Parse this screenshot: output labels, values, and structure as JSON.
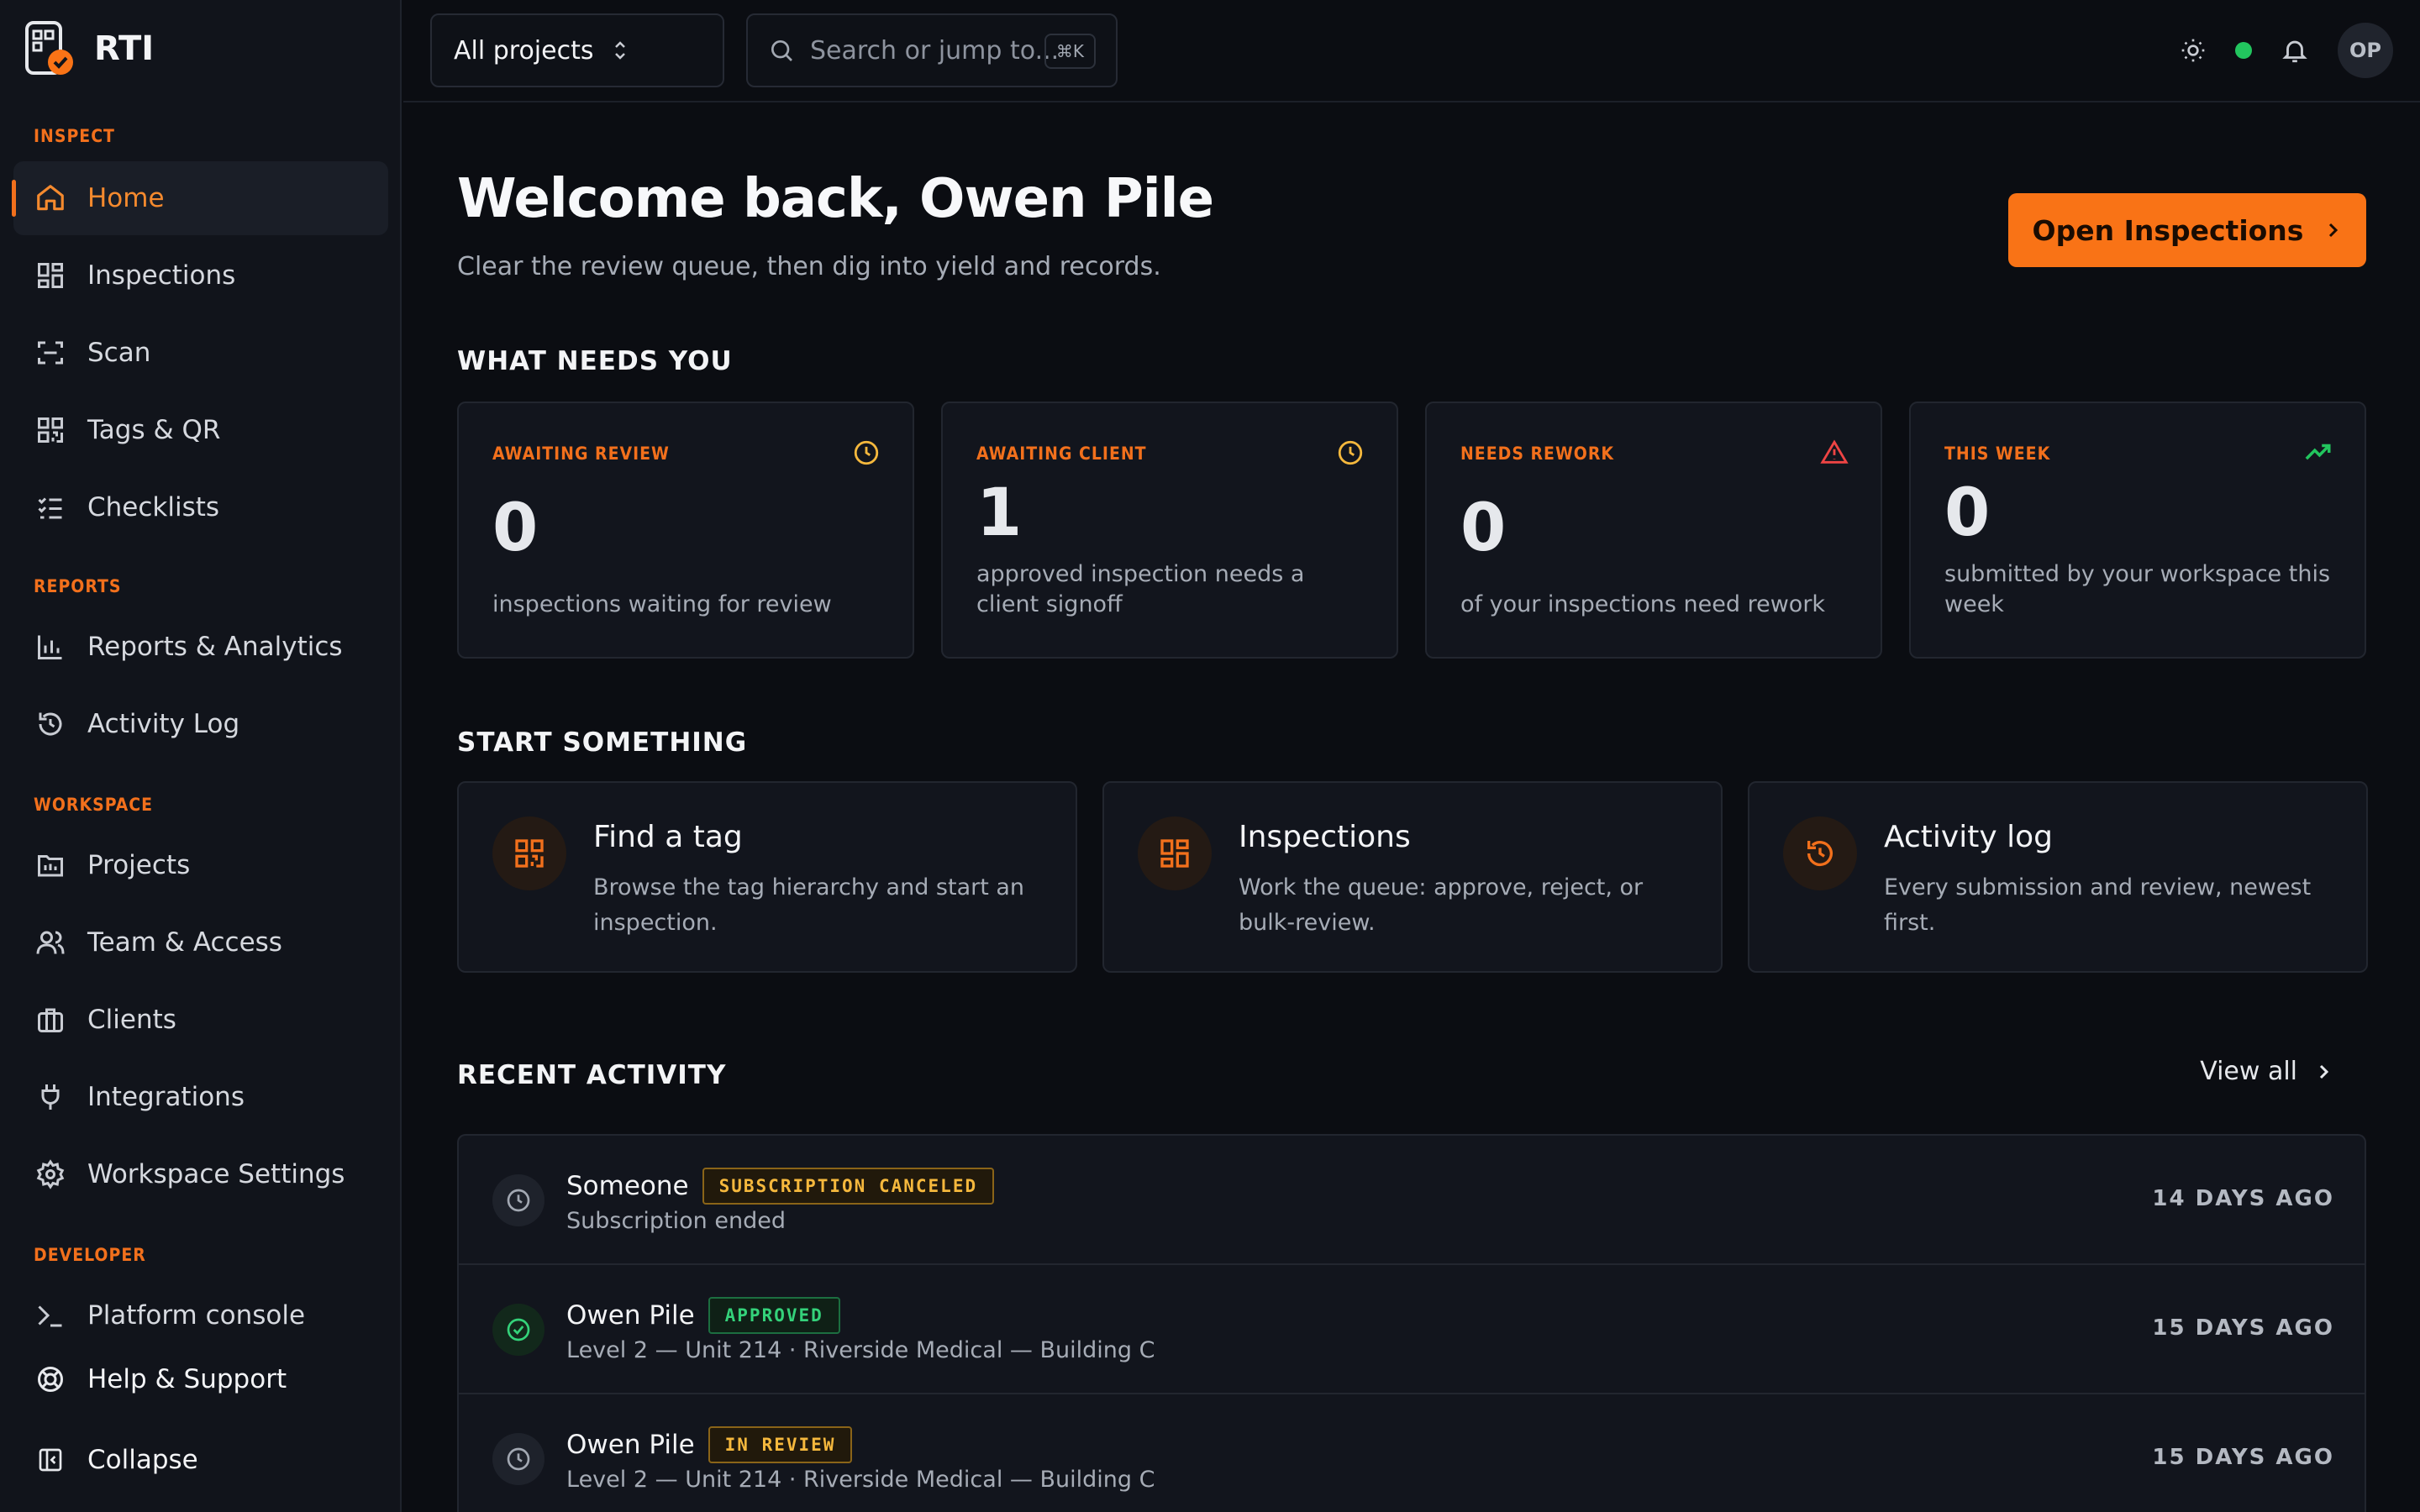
{
  "brand": {
    "name": "RTI"
  },
  "sidebar": {
    "sections": [
      {
        "label": "INSPECT",
        "items": [
          {
            "label": "Home",
            "icon": "home-icon",
            "active": true
          },
          {
            "label": "Inspections",
            "icon": "grid-icon"
          },
          {
            "label": "Scan",
            "icon": "scan-icon"
          },
          {
            "label": "Tags & QR",
            "icon": "qr-icon"
          },
          {
            "label": "Checklists",
            "icon": "checklist-icon"
          }
        ]
      },
      {
        "label": "REPORTS",
        "items": [
          {
            "label": "Reports & Analytics",
            "icon": "bar-chart-icon"
          },
          {
            "label": "Activity Log",
            "icon": "history-icon"
          }
        ]
      },
      {
        "label": "WORKSPACE",
        "items": [
          {
            "label": "Projects",
            "icon": "folder-icon"
          },
          {
            "label": "Team & Access",
            "icon": "users-icon"
          },
          {
            "label": "Clients",
            "icon": "briefcase-icon"
          },
          {
            "label": "Integrations",
            "icon": "plug-icon"
          },
          {
            "label": "Workspace Settings",
            "icon": "gear-icon"
          }
        ]
      },
      {
        "label": "DEVELOPER",
        "items": [
          {
            "label": "Platform console",
            "icon": "terminal-icon"
          }
        ]
      }
    ],
    "help": "Help & Support",
    "collapse": "Collapse"
  },
  "topbar": {
    "project_select": "All projects",
    "search_placeholder": "Search or jump to...",
    "search_shortcut": "⌘K",
    "avatar_initials": "OP",
    "status_color": "#22c55e"
  },
  "main": {
    "welcome": "Welcome back, Owen Pile",
    "subtitle": "Clear the review queue, then dig into yield and records.",
    "open_button": "Open Inspections",
    "needs_heading": "WHAT NEEDS YOU",
    "stats": [
      {
        "label": "AWAITING REVIEW",
        "value": "0",
        "desc": "inspections waiting for review",
        "icon": "clock-icon",
        "icon_color": "#f5b83d"
      },
      {
        "label": "AWAITING CLIENT",
        "value": "1",
        "desc": "approved inspection needs a client signoff",
        "icon": "clock-icon",
        "icon_color": "#f5b83d"
      },
      {
        "label": "NEEDS REWORK",
        "value": "0",
        "desc": "of your inspections need rework",
        "icon": "alert-triangle-icon",
        "icon_color": "#ef4444"
      },
      {
        "label": "THIS WEEK",
        "value": "0",
        "desc": "submitted by your workspace this week",
        "icon": "trending-up-icon",
        "icon_color": "#22c55e"
      }
    ],
    "start_heading": "START SOMETHING",
    "actions": [
      {
        "title": "Find a tag",
        "desc": "Browse the tag hierarchy and start an inspection.",
        "icon": "qr-icon"
      },
      {
        "title": "Inspections",
        "desc": "Work the queue: approve, reject, or bulk-review.",
        "icon": "grid-icon"
      },
      {
        "title": "Activity log",
        "desc": "Every submission and review, newest first.",
        "icon": "history-icon"
      }
    ],
    "recent_heading": "RECENT ACTIVITY",
    "view_all": "View all",
    "activity": [
      {
        "name": "Someone",
        "badge": "SUBSCRIPTION CANCELED",
        "badge_type": "warn",
        "sub": "Subscription ended",
        "time": "14 DAYS AGO",
        "icon": "clock-icon"
      },
      {
        "name": "Owen Pile",
        "badge": "APPROVED",
        "badge_type": "ok",
        "sub": "Level 2 — Unit 214 · Riverside Medical — Building C",
        "time": "15 DAYS AGO",
        "icon": "check-circle-icon"
      },
      {
        "name": "Owen Pile",
        "badge": "IN REVIEW",
        "badge_type": "warn",
        "sub": "Level 2 — Unit 214 · Riverside Medical — Building C",
        "time": "15 DAYS AGO",
        "icon": "clock-icon"
      }
    ]
  }
}
